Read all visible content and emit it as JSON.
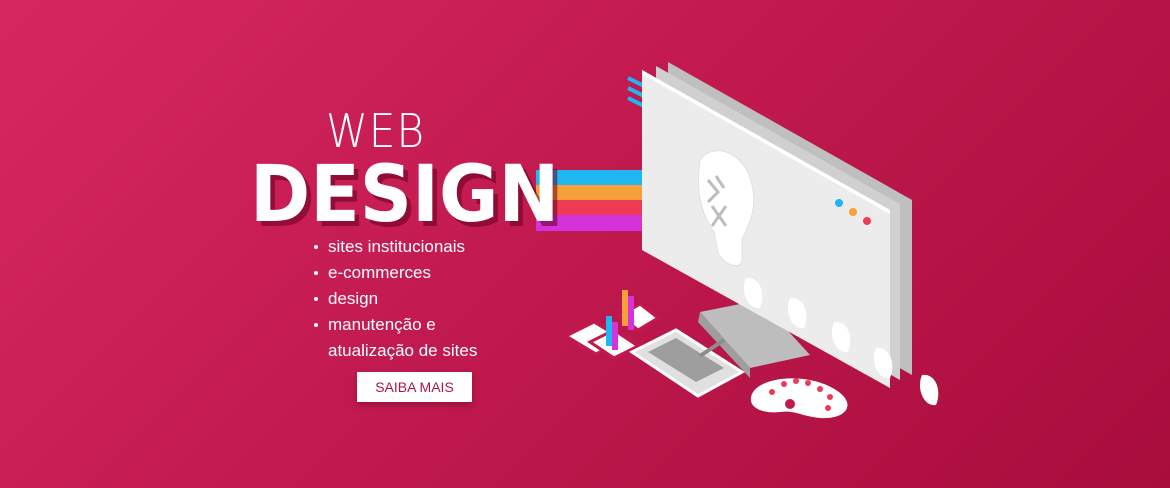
{
  "hero": {
    "title_top": "WEB",
    "title_bottom": "DESIGN",
    "features": [
      "sites institucionais",
      "e-commerces",
      "design",
      "manutenção e",
      "atualização de sites"
    ],
    "cta_label": "SAIBA MAIS"
  },
  "colors": {
    "background_start": "#d6285f",
    "background_end": "#a80d3c",
    "stripes": [
      "#1fb6f2",
      "#f7a03a",
      "#ee3b54",
      "#d632d9"
    ],
    "cta_text": "#b0153f"
  },
  "illustration": {
    "icons": [
      "monitor-icon",
      "lightbulb-icon",
      "chart-icon",
      "drawing-tablet-icon",
      "paint-palette-icon",
      "menu-lines-icon"
    ]
  }
}
